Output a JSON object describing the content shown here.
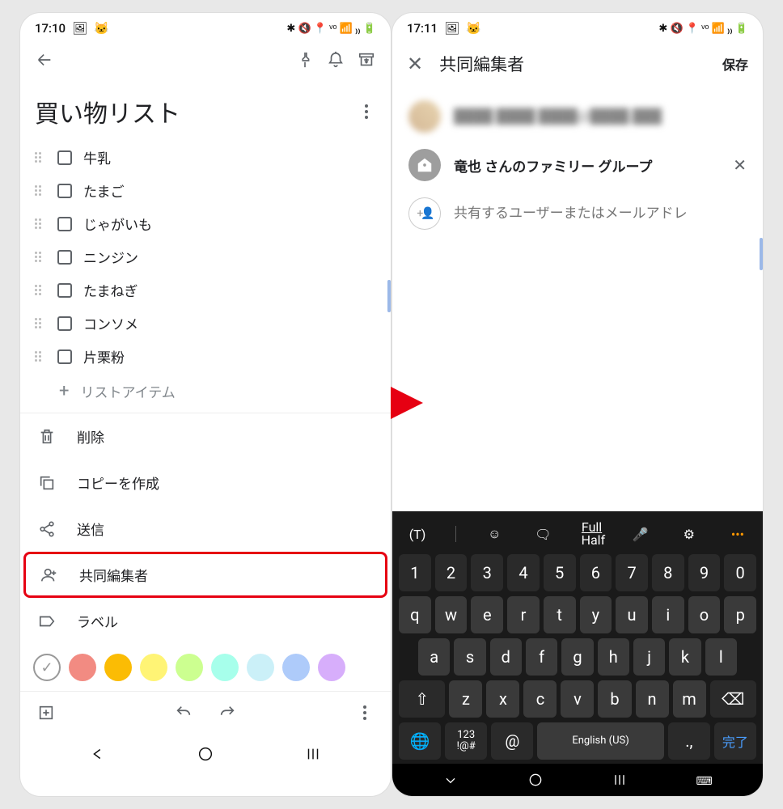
{
  "status": {
    "time_left": "17:10",
    "time_right": "17:11"
  },
  "left": {
    "title": "買い物リスト",
    "items": [
      "牛乳",
      "たまご",
      "じゃがいも",
      "ニンジン",
      "たまねぎ",
      "コンソメ",
      "片栗粉"
    ],
    "add_label": "リストアイテム",
    "menu": {
      "delete": "削除",
      "copy": "コピーを作成",
      "send": "送信",
      "collaborators": "共同編集者",
      "labels": "ラベル"
    },
    "colors": [
      "#ffffff",
      "#f28b82",
      "#fbbc04",
      "#fff475",
      "#ccff90",
      "#a7ffeb",
      "#cbf0f8",
      "#aecbfa",
      "#d7aefb"
    ]
  },
  "right": {
    "header_title": "共同編集者",
    "save": "保存",
    "owner_blur": "████ ████ ████@████.███",
    "group_name": "竜也 さんのファミリー グループ",
    "input_placeholder": "共有するユーザーまたはメールアドレ"
  },
  "keyboard": {
    "top_fullhalf": "Full\nHalf",
    "row_num": [
      "1",
      "2",
      "3",
      "4",
      "5",
      "6",
      "7",
      "8",
      "9",
      "0"
    ],
    "row_q": [
      "q",
      "w",
      "e",
      "r",
      "t",
      "y",
      "u",
      "i",
      "o",
      "p"
    ],
    "row_a": [
      "a",
      "s",
      "d",
      "f",
      "g",
      "h",
      "j",
      "k",
      "l"
    ],
    "row_z": [
      "z",
      "x",
      "c",
      "v",
      "b",
      "n",
      "m"
    ],
    "fn_123": "123\n!@#",
    "fn_lang": "English (US)",
    "fn_done": "完了"
  }
}
